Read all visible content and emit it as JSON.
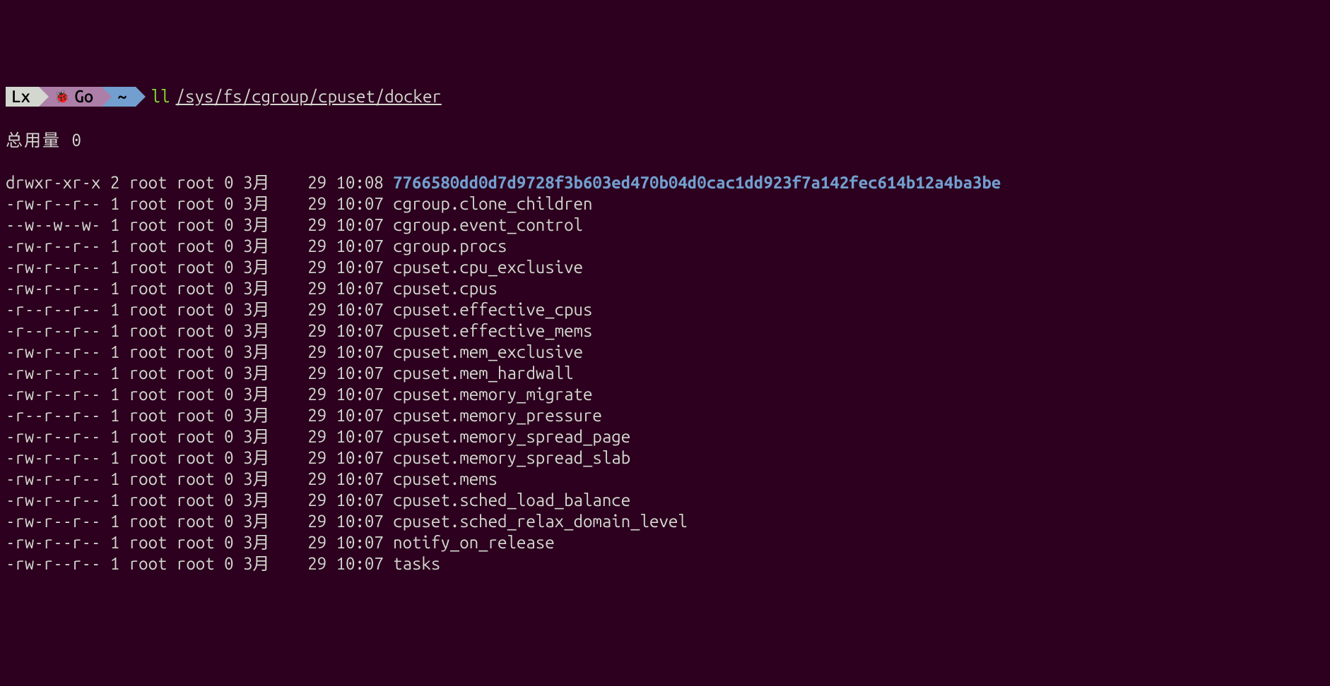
{
  "prompt": {
    "seg1": "Lx",
    "seg2": "Go",
    "seg3": "~",
    "command": "ll",
    "path": "/sys/fs/cgroup/cpuset/docker"
  },
  "total_line": "总用量 0",
  "listing": [
    {
      "perm": "drwxr-xr-x",
      "links": "2",
      "owner": "root",
      "group": "root",
      "size": "0",
      "month": "3月",
      "day": "29",
      "time": "10:08",
      "name": "7766580dd0d7d9728f3b603ed470b04d0cac1dd923f7a142fec614b12a4ba3be",
      "is_dir": true
    },
    {
      "perm": "-rw-r--r--",
      "links": "1",
      "owner": "root",
      "group": "root",
      "size": "0",
      "month": "3月",
      "day": "29",
      "time": "10:07",
      "name": "cgroup.clone_children",
      "is_dir": false
    },
    {
      "perm": "--w--w--w-",
      "links": "1",
      "owner": "root",
      "group": "root",
      "size": "0",
      "month": "3月",
      "day": "29",
      "time": "10:07",
      "name": "cgroup.event_control",
      "is_dir": false
    },
    {
      "perm": "-rw-r--r--",
      "links": "1",
      "owner": "root",
      "group": "root",
      "size": "0",
      "month": "3月",
      "day": "29",
      "time": "10:07",
      "name": "cgroup.procs",
      "is_dir": false
    },
    {
      "perm": "-rw-r--r--",
      "links": "1",
      "owner": "root",
      "group": "root",
      "size": "0",
      "month": "3月",
      "day": "29",
      "time": "10:07",
      "name": "cpuset.cpu_exclusive",
      "is_dir": false
    },
    {
      "perm": "-rw-r--r--",
      "links": "1",
      "owner": "root",
      "group": "root",
      "size": "0",
      "month": "3月",
      "day": "29",
      "time": "10:07",
      "name": "cpuset.cpus",
      "is_dir": false
    },
    {
      "perm": "-r--r--r--",
      "links": "1",
      "owner": "root",
      "group": "root",
      "size": "0",
      "month": "3月",
      "day": "29",
      "time": "10:07",
      "name": "cpuset.effective_cpus",
      "is_dir": false
    },
    {
      "perm": "-r--r--r--",
      "links": "1",
      "owner": "root",
      "group": "root",
      "size": "0",
      "month": "3月",
      "day": "29",
      "time": "10:07",
      "name": "cpuset.effective_mems",
      "is_dir": false
    },
    {
      "perm": "-rw-r--r--",
      "links": "1",
      "owner": "root",
      "group": "root",
      "size": "0",
      "month": "3月",
      "day": "29",
      "time": "10:07",
      "name": "cpuset.mem_exclusive",
      "is_dir": false
    },
    {
      "perm": "-rw-r--r--",
      "links": "1",
      "owner": "root",
      "group": "root",
      "size": "0",
      "month": "3月",
      "day": "29",
      "time": "10:07",
      "name": "cpuset.mem_hardwall",
      "is_dir": false
    },
    {
      "perm": "-rw-r--r--",
      "links": "1",
      "owner": "root",
      "group": "root",
      "size": "0",
      "month": "3月",
      "day": "29",
      "time": "10:07",
      "name": "cpuset.memory_migrate",
      "is_dir": false
    },
    {
      "perm": "-r--r--r--",
      "links": "1",
      "owner": "root",
      "group": "root",
      "size": "0",
      "month": "3月",
      "day": "29",
      "time": "10:07",
      "name": "cpuset.memory_pressure",
      "is_dir": false
    },
    {
      "perm": "-rw-r--r--",
      "links": "1",
      "owner": "root",
      "group": "root",
      "size": "0",
      "month": "3月",
      "day": "29",
      "time": "10:07",
      "name": "cpuset.memory_spread_page",
      "is_dir": false
    },
    {
      "perm": "-rw-r--r--",
      "links": "1",
      "owner": "root",
      "group": "root",
      "size": "0",
      "month": "3月",
      "day": "29",
      "time": "10:07",
      "name": "cpuset.memory_spread_slab",
      "is_dir": false
    },
    {
      "perm": "-rw-r--r--",
      "links": "1",
      "owner": "root",
      "group": "root",
      "size": "0",
      "month": "3月",
      "day": "29",
      "time": "10:07",
      "name": "cpuset.mems",
      "is_dir": false
    },
    {
      "perm": "-rw-r--r--",
      "links": "1",
      "owner": "root",
      "group": "root",
      "size": "0",
      "month": "3月",
      "day": "29",
      "time": "10:07",
      "name": "cpuset.sched_load_balance",
      "is_dir": false
    },
    {
      "perm": "-rw-r--r--",
      "links": "1",
      "owner": "root",
      "group": "root",
      "size": "0",
      "month": "3月",
      "day": "29",
      "time": "10:07",
      "name": "cpuset.sched_relax_domain_level",
      "is_dir": false
    },
    {
      "perm": "-rw-r--r--",
      "links": "1",
      "owner": "root",
      "group": "root",
      "size": "0",
      "month": "3月",
      "day": "29",
      "time": "10:07",
      "name": "notify_on_release",
      "is_dir": false
    },
    {
      "perm": "-rw-r--r--",
      "links": "1",
      "owner": "root",
      "group": "root",
      "size": "0",
      "month": "3月",
      "day": "29",
      "time": "10:07",
      "name": "tasks",
      "is_dir": false
    }
  ]
}
